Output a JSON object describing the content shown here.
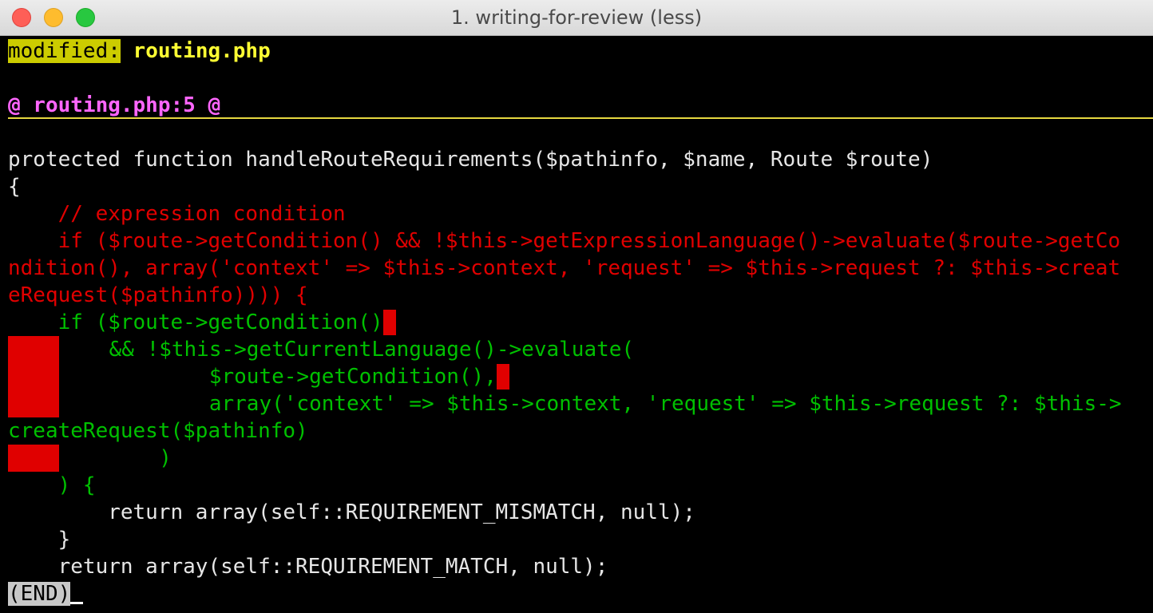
{
  "window": {
    "title": "1. writing-for-review (less)"
  },
  "header": {
    "status_label": "modified:",
    "filename": "routing.php"
  },
  "hunk": {
    "marker": "@ routing.php:5 @"
  },
  "code": {
    "l1": "protected function handleRouteRequirements($pathinfo, $name, Route $route)",
    "l2": "{",
    "l3": "    // expression condition",
    "l4": "    if ($route->getCondition() && !$this->getExpressionLanguage()->evaluate($route->getCo",
    "l5": "ndition(), array('context' => $this->context, 'request' => $this->request ?: $this->creat",
    "l6": "eRequest($pathinfo)))) {",
    "l7": "    if ($route->getCondition()",
    "l8": "    && !$this->getCurrentLanguage()->evaluate(",
    "l9": "            $route->getCondition(),",
    "l10": "            array('context' => $this->context, 'request' => $this->request ?: $this->",
    "l11": "createRequest($pathinfo)",
    "l12": "        )",
    "l13": "    ) {",
    "l14": "        return array(self::REQUIREMENT_MISMATCH, null);",
    "l15": "    }",
    "l16": "    return array(self::REQUIREMENT_MATCH, null);"
  },
  "footer": {
    "end_label": "(END)"
  },
  "colors": {
    "removed": "#e00000",
    "added": "#00c000",
    "hunk": "#ff66ff",
    "filename": "#ffff33"
  }
}
